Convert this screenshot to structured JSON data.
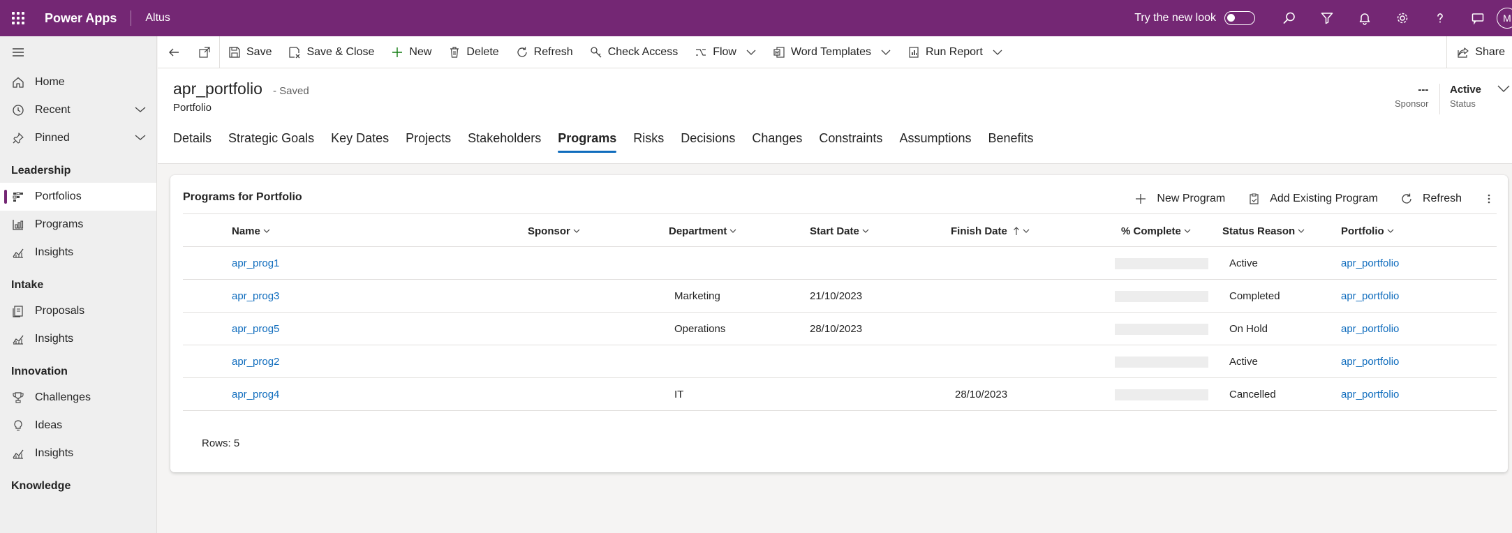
{
  "topbar": {
    "app_name": "Power Apps",
    "environment": "Altus",
    "try_new_look_label": "Try the new look",
    "avatar_initial": "M"
  },
  "sidebar": {
    "items_top": [
      {
        "label": "Home",
        "icon": "home-icon"
      },
      {
        "label": "Recent",
        "icon": "clock-icon"
      },
      {
        "label": "Pinned",
        "icon": "pin-icon"
      }
    ],
    "groups": [
      {
        "title": "Leadership",
        "items": [
          {
            "label": "Portfolios",
            "icon": "portfolio-icon",
            "selected": true
          },
          {
            "label": "Programs",
            "icon": "programs-icon"
          },
          {
            "label": "Insights",
            "icon": "insights-icon"
          }
        ]
      },
      {
        "title": "Intake",
        "items": [
          {
            "label": "Proposals",
            "icon": "proposals-icon"
          },
          {
            "label": "Insights",
            "icon": "insights-icon"
          }
        ]
      },
      {
        "title": "Innovation",
        "items": [
          {
            "label": "Challenges",
            "icon": "challenges-icon"
          },
          {
            "label": "Ideas",
            "icon": "lightbulb-icon"
          },
          {
            "label": "Insights",
            "icon": "insights-icon"
          }
        ]
      },
      {
        "title": "Knowledge",
        "items": []
      }
    ]
  },
  "commandbar": {
    "save": "Save",
    "save_close": "Save & Close",
    "new": "New",
    "delete": "Delete",
    "refresh": "Refresh",
    "check_access": "Check Access",
    "flow": "Flow",
    "word_templates": "Word Templates",
    "run_report": "Run Report",
    "share": "Share"
  },
  "header": {
    "title": "apr_portfolio",
    "saved_status": "- Saved",
    "entity": "Portfolio",
    "sponsor_value": "---",
    "sponsor_label": "Sponsor",
    "status_value": "Active",
    "status_label": "Status"
  },
  "tabs": [
    "Details",
    "Strategic Goals",
    "Key Dates",
    "Projects",
    "Stakeholders",
    "Programs",
    "Risks",
    "Decisions",
    "Changes",
    "Constraints",
    "Assumptions",
    "Benefits"
  ],
  "active_tab": "Programs",
  "subgrid": {
    "title": "Programs for Portfolio",
    "new_program": "New Program",
    "add_existing": "Add Existing Program",
    "refresh": "Refresh",
    "columns": {
      "name": "Name",
      "sponsor": "Sponsor",
      "department": "Department",
      "start_date": "Start Date",
      "finish_date": "Finish Date",
      "percent_complete": "% Complete",
      "status_reason": "Status Reason",
      "portfolio": "Portfolio"
    },
    "rows": [
      {
        "name": "apr_prog1",
        "sponsor": "",
        "department": "",
        "start_date": "",
        "finish_date": "",
        "percent_complete": 0,
        "status_reason": "Active",
        "portfolio": "apr_portfolio"
      },
      {
        "name": "apr_prog3",
        "sponsor": "",
        "department": "Marketing",
        "start_date": "21/10/2023",
        "finish_date": "",
        "percent_complete": 0,
        "status_reason": "Completed",
        "portfolio": "apr_portfolio"
      },
      {
        "name": "apr_prog5",
        "sponsor": "",
        "department": "Operations",
        "start_date": "28/10/2023",
        "finish_date": "",
        "percent_complete": 0,
        "status_reason": "On Hold",
        "portfolio": "apr_portfolio"
      },
      {
        "name": "apr_prog2",
        "sponsor": "",
        "department": "",
        "start_date": "",
        "finish_date": "",
        "percent_complete": 0,
        "status_reason": "Active",
        "portfolio": "apr_portfolio"
      },
      {
        "name": "apr_prog4",
        "sponsor": "",
        "department": "IT",
        "start_date": "",
        "finish_date": "28/10/2023",
        "percent_complete": 0,
        "status_reason": "Cancelled",
        "portfolio": "apr_portfolio"
      }
    ],
    "rows_count": "Rows: 5"
  }
}
